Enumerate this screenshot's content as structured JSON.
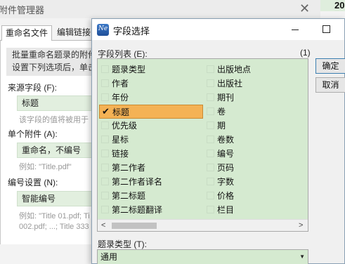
{
  "background_window": {
    "title": "附件管理器",
    "corner_text": "20",
    "tabs": [
      "重命名文件",
      "编辑链接"
    ],
    "info_text_line1": "批量重命名题录的附件",
    "info_text_line2": "设置下列选项后，单击",
    "source_label": "来源字段 (F):",
    "source_value": "标题",
    "source_hint": "该字段的值将被用于",
    "single_label": "单个附件 (A):",
    "single_value": "重命名，不编号",
    "single_example": "例如: \"Title.pdf\"",
    "number_label": "编号设置 (N):",
    "number_value": "智能编号",
    "number_example_line1": "例如: \"Title 01.pdf; Ti",
    "number_example_line2": "002.pdf; ...; Title 333"
  },
  "dialog": {
    "icon_text": "Ne",
    "title": "字段选择",
    "list_label": "字段列表 (E):",
    "count": "(1)",
    "ok_button": "确定",
    "cancel_button": "取消",
    "column1": [
      {
        "label": "题录类型",
        "checked": false
      },
      {
        "label": "作者",
        "checked": false
      },
      {
        "label": "年份",
        "checked": false
      },
      {
        "label": "标题",
        "checked": true
      },
      {
        "label": "优先级",
        "checked": false
      },
      {
        "label": "星标",
        "checked": false
      },
      {
        "label": "链接",
        "checked": false
      },
      {
        "label": "第二作者",
        "checked": false
      },
      {
        "label": "第二作者译名",
        "checked": false
      },
      {
        "label": "第二标题",
        "checked": false
      },
      {
        "label": "第二标题翻译",
        "checked": false
      }
    ],
    "column2": [
      {
        "label": "出版地点",
        "checked": false
      },
      {
        "label": "出版社",
        "checked": false
      },
      {
        "label": "期刊",
        "checked": false
      },
      {
        "label": "卷",
        "checked": false
      },
      {
        "label": "期",
        "checked": false
      },
      {
        "label": "卷数",
        "checked": false
      },
      {
        "label": "编号",
        "checked": false
      },
      {
        "label": "页码",
        "checked": false
      },
      {
        "label": "字数",
        "checked": false
      },
      {
        "label": "价格",
        "checked": false
      },
      {
        "label": "栏目",
        "checked": false
      }
    ],
    "type_label": "题录类型 (T):",
    "type_value": "通用"
  },
  "colors": {
    "list_background": "#d5ead0",
    "selection": "#f4b255"
  }
}
